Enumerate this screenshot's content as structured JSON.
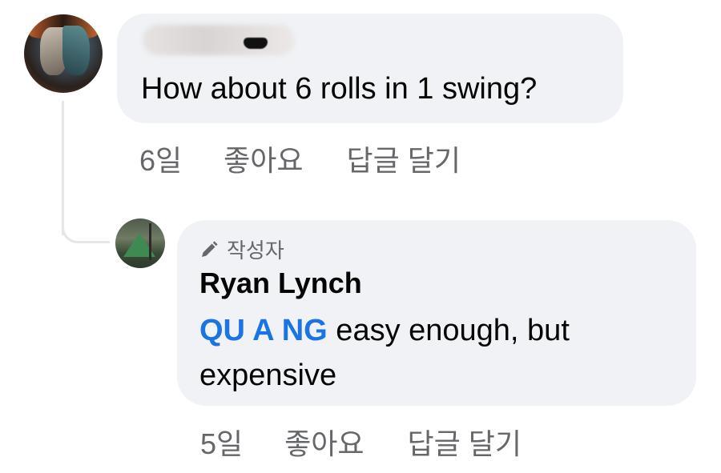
{
  "comments": [
    {
      "author_display": "",
      "text": "How about 6 rolls in 1 swing?",
      "time": "6일",
      "like_label": "좋아요",
      "reply_label": "답글 달기"
    }
  ],
  "reply": {
    "badge": "작성자",
    "author": "Ryan Lynch",
    "mention": "QU A NG",
    "text": " easy enough, but expensive",
    "time": "5일",
    "like_label": "좋아요",
    "reply_label": "답글 달기"
  },
  "colors": {
    "bubble": "#f0f2f5",
    "mention": "#1b74e4",
    "secondary_text": "#65676b",
    "thread_line": "#e4e6ea"
  },
  "icons": {
    "author_badge": "pencil-icon"
  }
}
